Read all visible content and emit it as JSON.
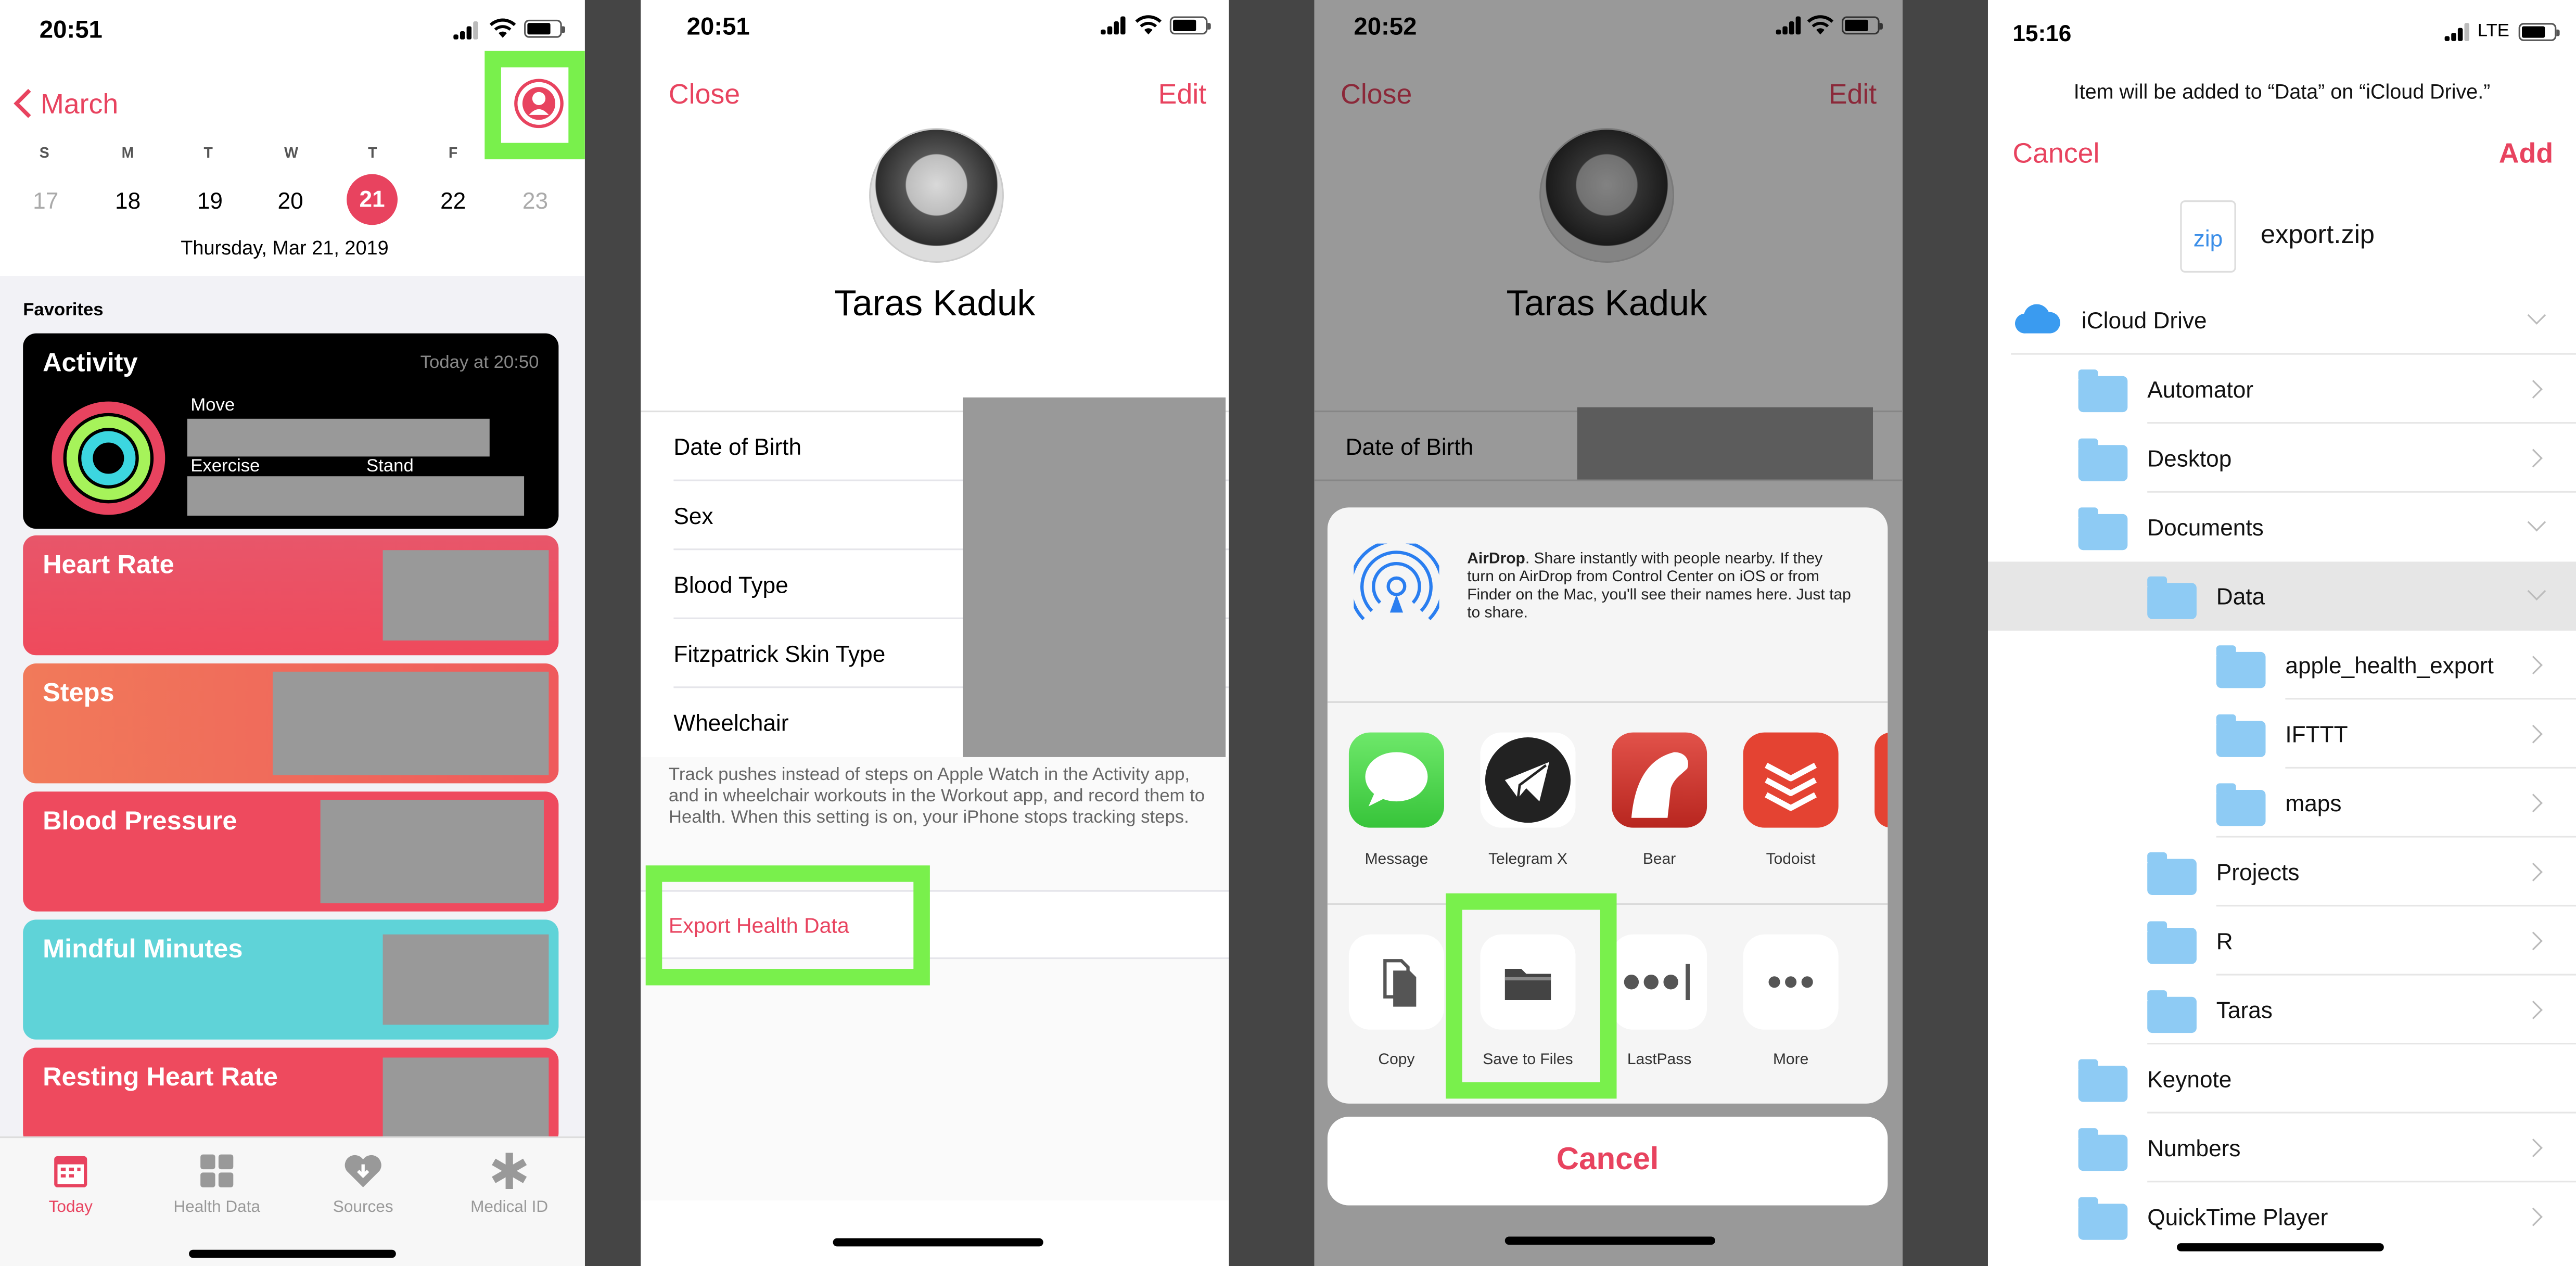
{
  "panel1": {
    "time": "20:51",
    "back": "March",
    "weekdays": [
      "S",
      "M",
      "T",
      "W",
      "T",
      "F",
      ""
    ],
    "dates": [
      "17",
      "18",
      "19",
      "20",
      "21",
      "22",
      "23"
    ],
    "date_line": "Thursday, Mar 21, 2019",
    "favorites": "Favorites",
    "activity": {
      "title": "Activity",
      "when": "Today at 20:50",
      "move": "Move",
      "exercise": "Exercise",
      "stand": "Stand"
    },
    "cards": [
      "Heart Rate",
      "Steps",
      "Blood Pressure",
      "Mindful Minutes",
      "Resting Heart Rate"
    ],
    "tabs": [
      "Today",
      "Health Data",
      "Sources",
      "Medical ID"
    ],
    "colors": {
      "accent": "#e8435f",
      "highlight": "#79f04c"
    }
  },
  "panel2": {
    "time": "20:51",
    "close": "Close",
    "edit": "Edit",
    "name": "Taras Kaduk",
    "rows": [
      "Date of Birth",
      "Sex",
      "Blood Type",
      "Fitzpatrick Skin Type",
      "Wheelchair"
    ],
    "note": "Track pushes instead of steps on Apple Watch in the Activity app, and in wheelchair workouts in the Workout app, and record them to Health. When this setting is on, your iPhone stops tracking steps.",
    "export": "Export Health Data"
  },
  "panel3": {
    "time": "20:52",
    "close": "Close",
    "edit": "Edit",
    "name": "Taras Kaduk",
    "row": "Date of Birth",
    "airdrop_title": "AirDrop",
    "airdrop_text": ". Share instantly with people nearby. If they turn on AirDrop from Control Center on iOS or from Finder on the Mac, you'll see their names here. Just tap to share.",
    "apps": [
      "Message",
      "Telegram X",
      "Bear",
      "Todoist"
    ],
    "actions": [
      "Copy",
      "Save to Files",
      "LastPass",
      "More"
    ],
    "cancel": "Cancel"
  },
  "panel4": {
    "time": "15:16",
    "network": "LTE",
    "header": "Item will be added to “Data” on “iCloud Drive.”",
    "cancel": "Cancel",
    "add": "Add",
    "file_ext": "zip",
    "file": "export.zip",
    "items": [
      "iCloud Drive",
      "Automator",
      "Desktop",
      "Documents",
      "Data",
      "apple_health_export",
      "IFTTT",
      "maps",
      "Projects",
      "R",
      "Taras",
      "Keynote",
      "Numbers",
      "QuickTime Player"
    ]
  }
}
